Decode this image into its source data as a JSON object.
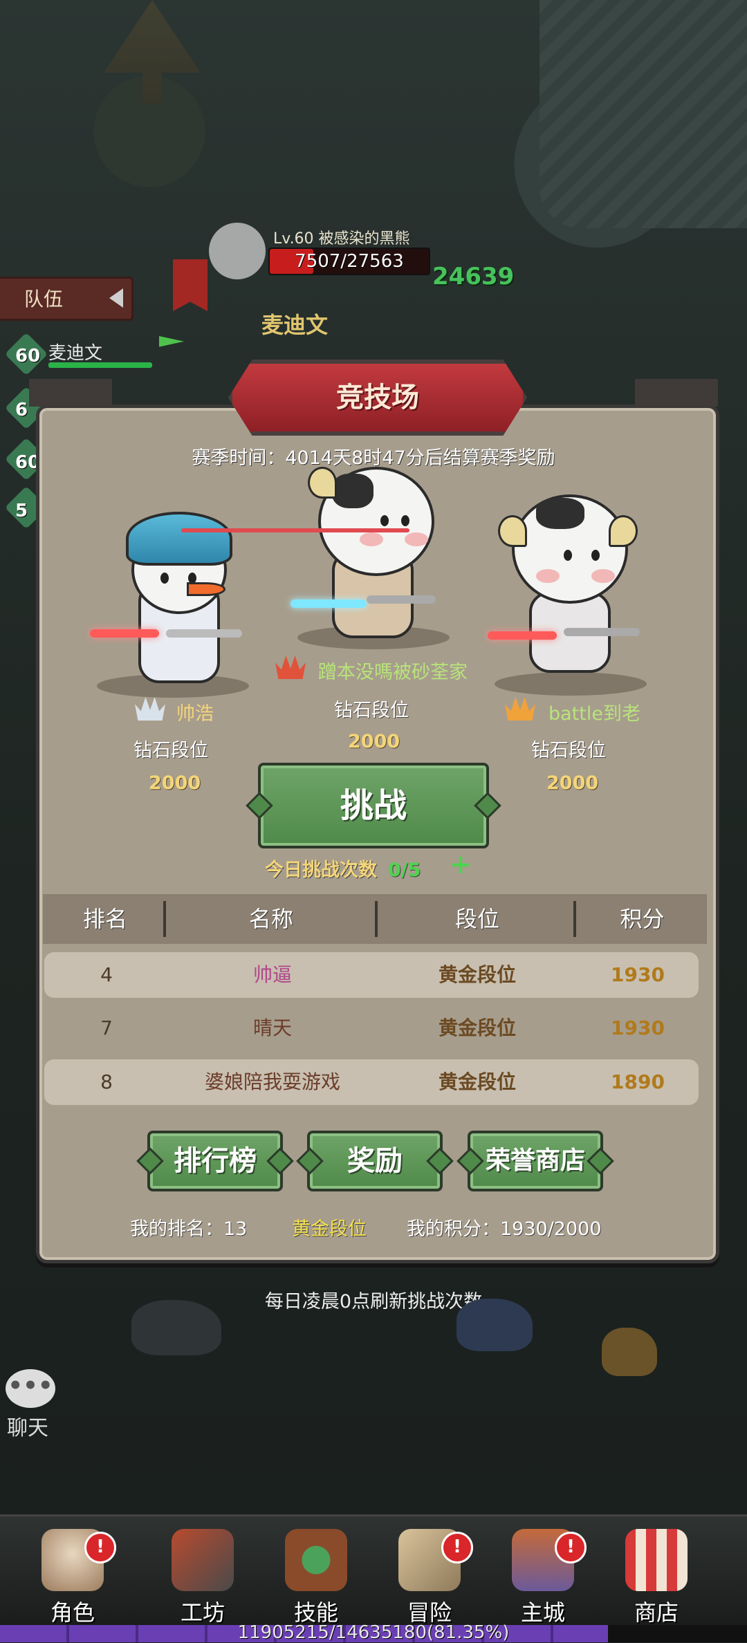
{
  "hud": {
    "team_tab": "队伍",
    "member_name": "麦迪文",
    "member_levels": [
      "60",
      "6",
      "60",
      "5"
    ],
    "enemy_name": "Lv.60 被感染的黑熊",
    "enemy_hp": "7507/27563",
    "enemy_hp_ratio": 0.272,
    "damage_number": "24639",
    "player_name": "麦迪文"
  },
  "arena": {
    "title": "竞技场",
    "season_text": "赛季时间：4014天8时47分后结算赛季奖励",
    "opponents": [
      {
        "name": "帅浩",
        "tier": "钻石段位",
        "score": "2000",
        "name_color": "#f3d57a"
      },
      {
        "name": "蹭本没嗎被砂荃家",
        "tier": "钻石段位",
        "score": "2000",
        "name_color": "#b8e47a"
      },
      {
        "name": "battle到老",
        "tier": "钻石段位",
        "score": "2000",
        "name_color": "#b8e47a"
      }
    ],
    "challenge_button": "挑战",
    "daily_label": "今日挑战次数",
    "daily_count": "0/5",
    "plus": "+",
    "table": {
      "headers": [
        "排名",
        "名称",
        "段位",
        "积分"
      ],
      "rows": [
        {
          "rank": "4",
          "name": "帅逼",
          "tier": "黄金段位",
          "score": "1930",
          "name_color": "#b0488a"
        },
        {
          "rank": "7",
          "name": "晴天",
          "tier": "黄金段位",
          "score": "1930",
          "name_color": "#6b3d2a"
        },
        {
          "rank": "8",
          "name": "婆娘陪我耍游戏",
          "tier": "黄金段位",
          "score": "1890",
          "name_color": "#6b3d2a"
        }
      ]
    },
    "buttons": {
      "leaderboard": "排行榜",
      "rewards": "奖励",
      "honor_shop": "荣誉商店"
    },
    "my_rank_label": "我的排名：13",
    "my_tier": "黄金段位",
    "my_score_label": "我的积分：1930/2000"
  },
  "refresh_note": "每日凌晨0点刷新挑战次数",
  "chat": {
    "icon": "•••",
    "label": "聊天"
  },
  "nav": [
    {
      "label": "角色",
      "badge": "!"
    },
    {
      "label": "工坊",
      "badge": ""
    },
    {
      "label": "技能",
      "badge": ""
    },
    {
      "label": "冒险",
      "badge": "!"
    },
    {
      "label": "主城",
      "badge": "!"
    },
    {
      "label": "商店",
      "badge": ""
    }
  ],
  "xp": {
    "text": "11905215/14635180(81.35%)",
    "ratio": 0.8135
  },
  "colors": {
    "accent_green": "#4f8a4a",
    "title_red": "#c23a3f",
    "gold": "#f3d57a"
  }
}
